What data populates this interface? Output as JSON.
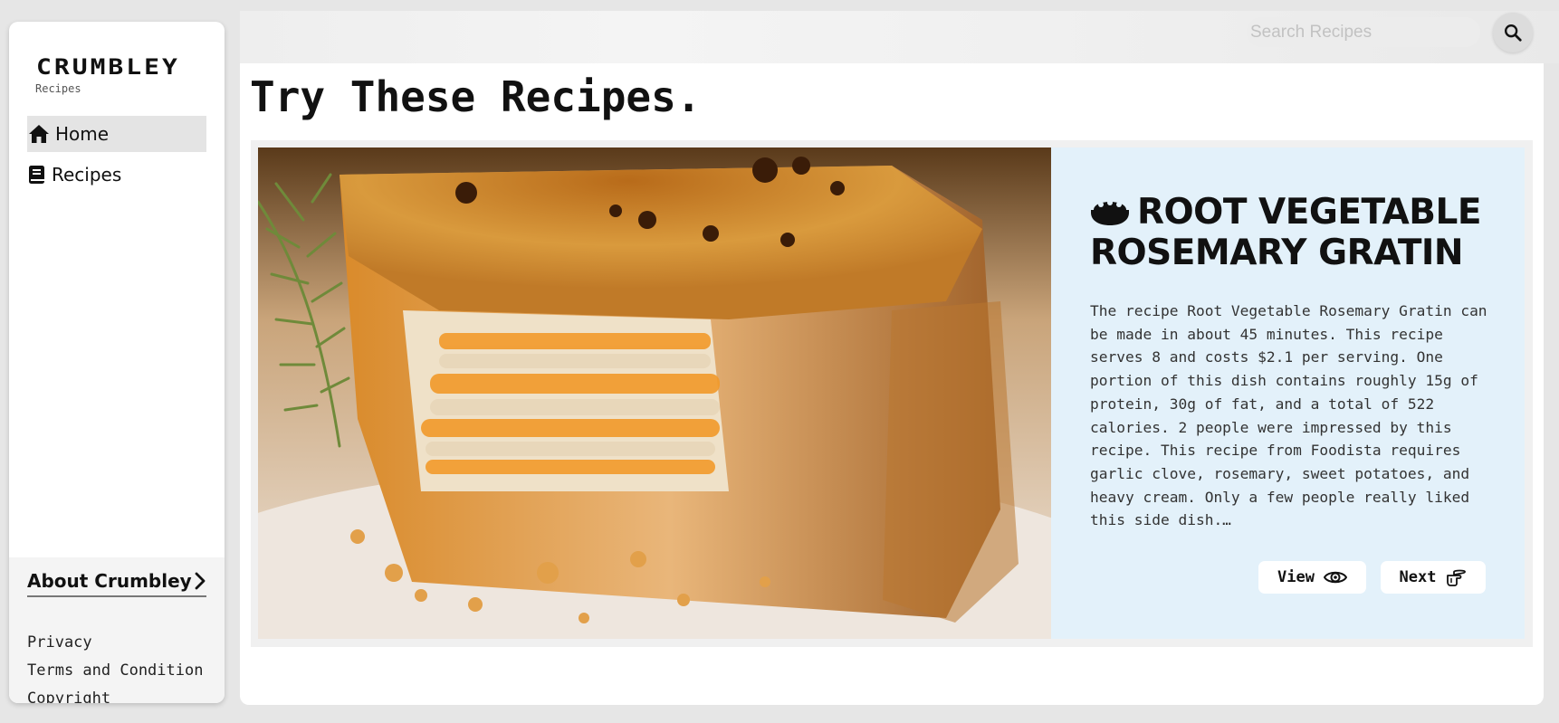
{
  "brand": {
    "logo": "CRUMBLEY",
    "subtitle": "Recipes"
  },
  "search": {
    "placeholder": "Search Recipes",
    "value": "",
    "icon": "search-icon"
  },
  "sidebar": {
    "items": [
      {
        "label": "Home",
        "icon": "home-icon",
        "active": true
      },
      {
        "label": "Recipes",
        "icon": "book-icon",
        "active": false
      }
    ],
    "about": {
      "title": "About Crumbley",
      "icon": "chevron-right-icon",
      "links": [
        "Privacy",
        "Terms and Condition",
        "Copyright"
      ]
    }
  },
  "main": {
    "title": "Try These Recipes.",
    "recipe": {
      "icon": "bowl-icon",
      "title": "ROOT VEGETABLE ROSEMARY GRATIN",
      "description": "The recipe Root Vegetable Rosemary Gratin can be made in about 45 minutes. This recipe serves 8 and costs $2.1 per serving. One portion of this dish contains roughly 15g of protein, 30g of fat, and a total of 522 calories. 2 people were impressed by this recipe. This recipe from Foodista requires garlic clove, rosemary, sweet potatoes, and heavy cream. Only a few people really liked this side dish.…",
      "buttons": {
        "view": {
          "label": "View",
          "icon": "eye-icon"
        },
        "next": {
          "label": "Next",
          "icon": "pointing-hand-icon"
        }
      }
    }
  },
  "colors": {
    "info_panel_bg": "#e3f1fa",
    "active_nav_bg": "#e4e4e4",
    "page_bg": "#e6e6e6"
  }
}
